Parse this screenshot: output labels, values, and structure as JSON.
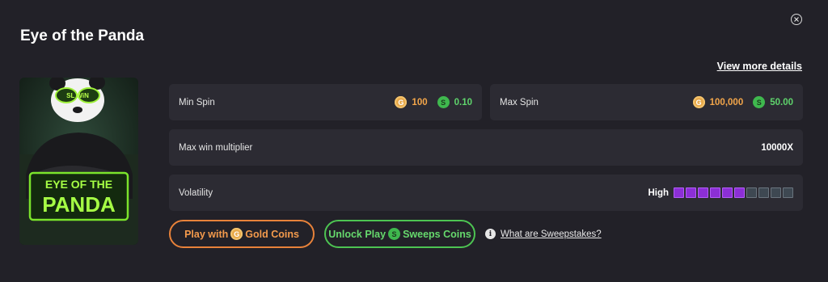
{
  "header": {
    "title": "Eye of the Panda",
    "view_more": "View more details"
  },
  "thumbnail": {
    "logo_line1": "EYE OF THE",
    "logo_line2": "PANDA",
    "glasses_text": "SL WiN"
  },
  "min_spin": {
    "label": "Min Spin",
    "gold_icon": "G",
    "gold_value": "100",
    "sweep_icon": "S",
    "sweep_value": "0.10"
  },
  "max_spin": {
    "label": "Max Spin",
    "gold_icon": "G",
    "gold_value": "100,000",
    "sweep_icon": "S",
    "sweep_value": "50.00"
  },
  "max_win": {
    "label": "Max win multiplier",
    "value": "10000X"
  },
  "volatility": {
    "label": "Volatility",
    "level": "High",
    "filled": 6,
    "total": 10,
    "on_color": "#8c2fd6",
    "off_color": "#3e4852"
  },
  "buttons": {
    "gold": {
      "prefix": "Play with",
      "icon": "G",
      "suffix": "Gold Coins"
    },
    "sweep": {
      "prefix": "Unlock Play",
      "icon": "S",
      "suffix": "Sweeps Coins"
    }
  },
  "help": {
    "icon": "i",
    "text": "What are Sweepstakes?"
  },
  "colors": {
    "gold": "#f3a64a",
    "sweep": "#5fd46c",
    "background": "#222128",
    "card": "#2c2b33"
  }
}
